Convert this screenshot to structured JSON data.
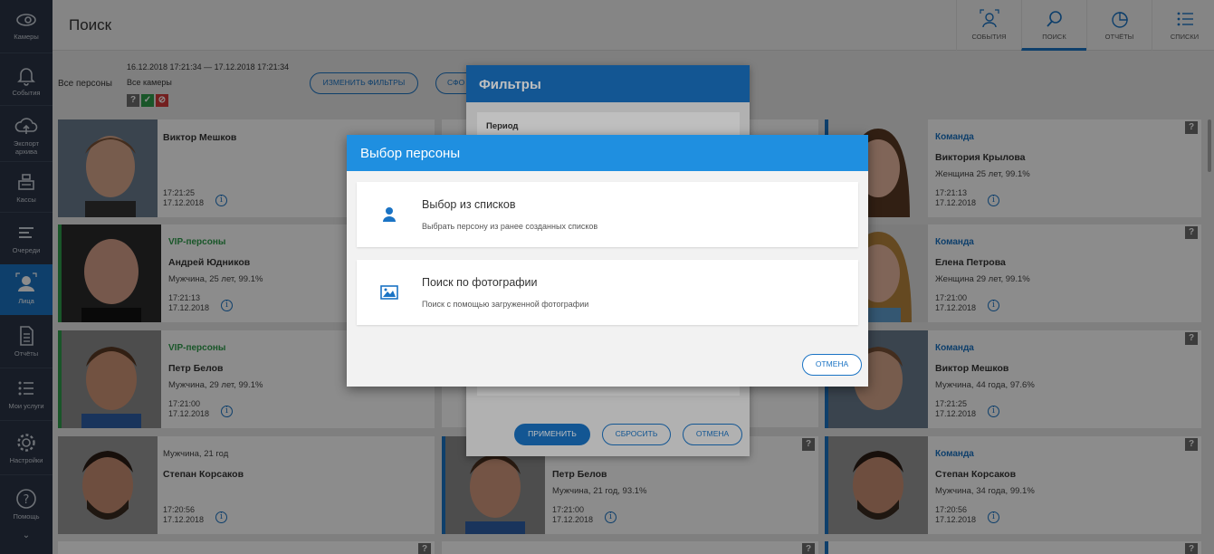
{
  "sidebar": {
    "items": [
      {
        "label": "Камеры",
        "icon": "cameras-icon"
      },
      {
        "label": "События",
        "icon": "bell-icon"
      },
      {
        "label": "Экспорт архива",
        "icon": "cloud-upload-icon"
      },
      {
        "label": "Кассы",
        "icon": "cash-register-icon"
      },
      {
        "label": "Очереди",
        "icon": "queue-icon"
      },
      {
        "label": "Лица",
        "icon": "face-icon"
      },
      {
        "label": "Отчёты",
        "icon": "document-icon"
      },
      {
        "label": "Мои услуги",
        "icon": "list-icon"
      },
      {
        "label": "Настройки",
        "icon": "gear-icon"
      },
      {
        "label": "Помощь",
        "icon": "help-icon"
      }
    ]
  },
  "header": {
    "title": "Поиск",
    "tabs": [
      {
        "label": "СОБЫТИЯ",
        "icon": "person-scan-icon"
      },
      {
        "label": "ПОИСК",
        "icon": "search-icon"
      },
      {
        "label": "ОТЧЁТЫ",
        "icon": "pie-chart-icon"
      },
      {
        "label": "СПИСКИ",
        "icon": "list-icon"
      }
    ]
  },
  "filterbar": {
    "all_persons": "Все персоны",
    "date_range": "16.12.2018 17:21:34 — 17.12.2018 17:21:34",
    "all_cameras": "Все камеры",
    "change_filters": "ИЗМЕНИТЬ ФИЛЬТРЫ",
    "second_button_partial": "СФО"
  },
  "cards": [
    {
      "group": "",
      "name": "Виктор Мешков",
      "desc": "",
      "time": "17:21:25",
      "date": "17.12.2018"
    },
    {
      "group": "VIP-персоны",
      "name": "Андрей Юдников",
      "desc": "Мужчина, 25 лет, 99.1%",
      "time": "17:21:13",
      "date": "17.12.2018"
    },
    {
      "group": "VIP-персоны",
      "name": "Петр Белов",
      "desc": "Мужчина, 29 лет, 99.1%",
      "time": "17:21:00",
      "date": "17.12.2018"
    },
    {
      "group": "",
      "name": "Степан Корсаков",
      "desc": "Мужчина, 21 год",
      "time": "17:20:56",
      "date": "17.12.2018"
    },
    {
      "group": "",
      "name": "Петр Белов",
      "desc": "Мужчина, 21 год, 93.1%",
      "time": "17:21:00",
      "date": "17.12.2018"
    },
    {
      "group": "Команда",
      "name": "Виктория Крылова",
      "desc": "Женщина 25 лет, 99.1%",
      "time": "17:21:13",
      "date": "17.12.2018"
    },
    {
      "group": "Команда",
      "name": "Елена Петрова",
      "desc": "Женщина 29 лет, 99.1%",
      "time": "17:21:00",
      "date": "17.12.2018"
    },
    {
      "group": "Команда",
      "name": "Виктор Мешков",
      "desc": "Мужчина, 44 года, 97.6%",
      "time": "17:21:25",
      "date": "17.12.2018"
    },
    {
      "group": "Команда",
      "name": "Степан Корсаков",
      "desc": "Мужчина, 34 года, 99.1%",
      "time": "17:20:56",
      "date": "17.12.2018"
    }
  ],
  "filters_dialog": {
    "title": "Фильтры",
    "period_label": "Период",
    "apply": "ПРИМЕНИТЬ",
    "reset": "СБРОСИТЬ",
    "cancel": "ОТМЕНА"
  },
  "person_dialog": {
    "title": "Выбор персоны",
    "options": [
      {
        "title": "Выбор из списков",
        "subtitle": "Выбрать персону из ранее созданных списков",
        "icon": "person-icon"
      },
      {
        "title": "Поиск по фотографии",
        "subtitle": "Поиск с помощью загруженной фотографии",
        "icon": "image-icon"
      }
    ],
    "cancel": "ОТМЕНА"
  },
  "colors": {
    "accent": "#1a73c4",
    "sidebar": "#2b3445",
    "vip": "#2e9d4b",
    "dialog_header": "#1f8fe0"
  }
}
